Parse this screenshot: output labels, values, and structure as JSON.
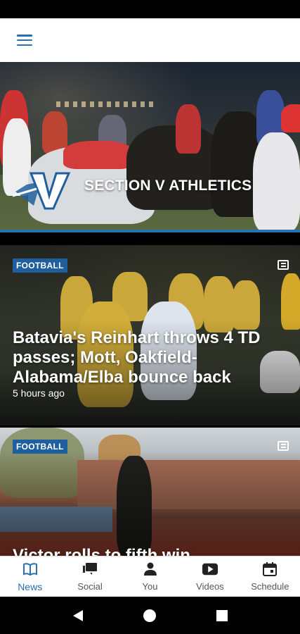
{
  "hero": {
    "title": "SECTION V ATHLETICS",
    "logo_letter": "V"
  },
  "articles": [
    {
      "category": "FOOTBALL",
      "headline": "Batavia's Reinhart throws 4 TD passes; Mott, Oakfield-Alabama/Elba bounce back",
      "timestamp": "5 hours ago",
      "type_icon": "article-icon"
    },
    {
      "category": "FOOTBALL",
      "headline": "Victor rolls to fifth win",
      "type_icon": "article-icon"
    }
  ],
  "bottom_nav": {
    "items": [
      {
        "label": "News",
        "icon": "book-icon",
        "active": true
      },
      {
        "label": "Social",
        "icon": "chat-icon"
      },
      {
        "label": "You",
        "icon": "person-icon"
      },
      {
        "label": "Videos",
        "icon": "play-icon"
      },
      {
        "label": "Schedule",
        "icon": "calendar-icon"
      }
    ]
  },
  "colors": {
    "accent": "#2a6fb0",
    "badge": "#1f5f9e"
  }
}
